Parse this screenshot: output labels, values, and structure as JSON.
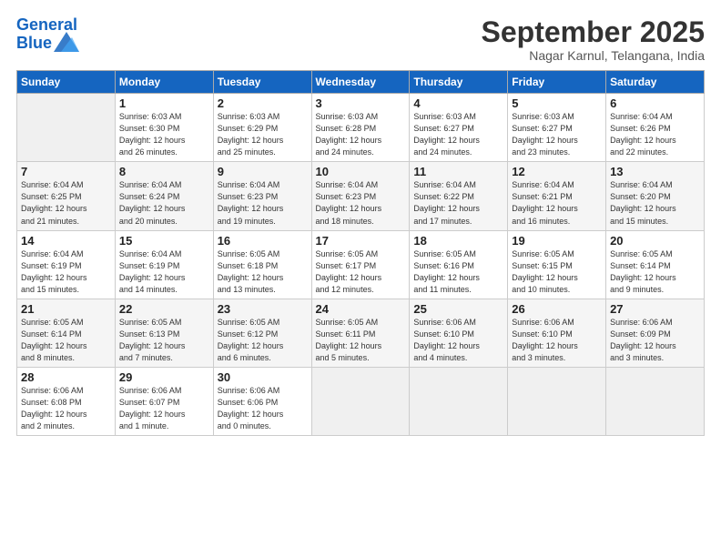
{
  "header": {
    "logo_line1": "General",
    "logo_line2": "Blue",
    "month": "September 2025",
    "location": "Nagar Karnul, Telangana, India"
  },
  "days_of_week": [
    "Sunday",
    "Monday",
    "Tuesday",
    "Wednesday",
    "Thursday",
    "Friday",
    "Saturday"
  ],
  "weeks": [
    [
      {
        "num": "",
        "info": ""
      },
      {
        "num": "1",
        "info": "Sunrise: 6:03 AM\nSunset: 6:30 PM\nDaylight: 12 hours\nand 26 minutes."
      },
      {
        "num": "2",
        "info": "Sunrise: 6:03 AM\nSunset: 6:29 PM\nDaylight: 12 hours\nand 25 minutes."
      },
      {
        "num": "3",
        "info": "Sunrise: 6:03 AM\nSunset: 6:28 PM\nDaylight: 12 hours\nand 24 minutes."
      },
      {
        "num": "4",
        "info": "Sunrise: 6:03 AM\nSunset: 6:27 PM\nDaylight: 12 hours\nand 24 minutes."
      },
      {
        "num": "5",
        "info": "Sunrise: 6:03 AM\nSunset: 6:27 PM\nDaylight: 12 hours\nand 23 minutes."
      },
      {
        "num": "6",
        "info": "Sunrise: 6:04 AM\nSunset: 6:26 PM\nDaylight: 12 hours\nand 22 minutes."
      }
    ],
    [
      {
        "num": "7",
        "info": "Sunrise: 6:04 AM\nSunset: 6:25 PM\nDaylight: 12 hours\nand 21 minutes."
      },
      {
        "num": "8",
        "info": "Sunrise: 6:04 AM\nSunset: 6:24 PM\nDaylight: 12 hours\nand 20 minutes."
      },
      {
        "num": "9",
        "info": "Sunrise: 6:04 AM\nSunset: 6:23 PM\nDaylight: 12 hours\nand 19 minutes."
      },
      {
        "num": "10",
        "info": "Sunrise: 6:04 AM\nSunset: 6:23 PM\nDaylight: 12 hours\nand 18 minutes."
      },
      {
        "num": "11",
        "info": "Sunrise: 6:04 AM\nSunset: 6:22 PM\nDaylight: 12 hours\nand 17 minutes."
      },
      {
        "num": "12",
        "info": "Sunrise: 6:04 AM\nSunset: 6:21 PM\nDaylight: 12 hours\nand 16 minutes."
      },
      {
        "num": "13",
        "info": "Sunrise: 6:04 AM\nSunset: 6:20 PM\nDaylight: 12 hours\nand 15 minutes."
      }
    ],
    [
      {
        "num": "14",
        "info": "Sunrise: 6:04 AM\nSunset: 6:19 PM\nDaylight: 12 hours\nand 15 minutes."
      },
      {
        "num": "15",
        "info": "Sunrise: 6:04 AM\nSunset: 6:19 PM\nDaylight: 12 hours\nand 14 minutes."
      },
      {
        "num": "16",
        "info": "Sunrise: 6:05 AM\nSunset: 6:18 PM\nDaylight: 12 hours\nand 13 minutes."
      },
      {
        "num": "17",
        "info": "Sunrise: 6:05 AM\nSunset: 6:17 PM\nDaylight: 12 hours\nand 12 minutes."
      },
      {
        "num": "18",
        "info": "Sunrise: 6:05 AM\nSunset: 6:16 PM\nDaylight: 12 hours\nand 11 minutes."
      },
      {
        "num": "19",
        "info": "Sunrise: 6:05 AM\nSunset: 6:15 PM\nDaylight: 12 hours\nand 10 minutes."
      },
      {
        "num": "20",
        "info": "Sunrise: 6:05 AM\nSunset: 6:14 PM\nDaylight: 12 hours\nand 9 minutes."
      }
    ],
    [
      {
        "num": "21",
        "info": "Sunrise: 6:05 AM\nSunset: 6:14 PM\nDaylight: 12 hours\nand 8 minutes."
      },
      {
        "num": "22",
        "info": "Sunrise: 6:05 AM\nSunset: 6:13 PM\nDaylight: 12 hours\nand 7 minutes."
      },
      {
        "num": "23",
        "info": "Sunrise: 6:05 AM\nSunset: 6:12 PM\nDaylight: 12 hours\nand 6 minutes."
      },
      {
        "num": "24",
        "info": "Sunrise: 6:05 AM\nSunset: 6:11 PM\nDaylight: 12 hours\nand 5 minutes."
      },
      {
        "num": "25",
        "info": "Sunrise: 6:06 AM\nSunset: 6:10 PM\nDaylight: 12 hours\nand 4 minutes."
      },
      {
        "num": "26",
        "info": "Sunrise: 6:06 AM\nSunset: 6:10 PM\nDaylight: 12 hours\nand 3 minutes."
      },
      {
        "num": "27",
        "info": "Sunrise: 6:06 AM\nSunset: 6:09 PM\nDaylight: 12 hours\nand 3 minutes."
      }
    ],
    [
      {
        "num": "28",
        "info": "Sunrise: 6:06 AM\nSunset: 6:08 PM\nDaylight: 12 hours\nand 2 minutes."
      },
      {
        "num": "29",
        "info": "Sunrise: 6:06 AM\nSunset: 6:07 PM\nDaylight: 12 hours\nand 1 minute."
      },
      {
        "num": "30",
        "info": "Sunrise: 6:06 AM\nSunset: 6:06 PM\nDaylight: 12 hours\nand 0 minutes."
      },
      {
        "num": "",
        "info": ""
      },
      {
        "num": "",
        "info": ""
      },
      {
        "num": "",
        "info": ""
      },
      {
        "num": "",
        "info": ""
      }
    ]
  ]
}
